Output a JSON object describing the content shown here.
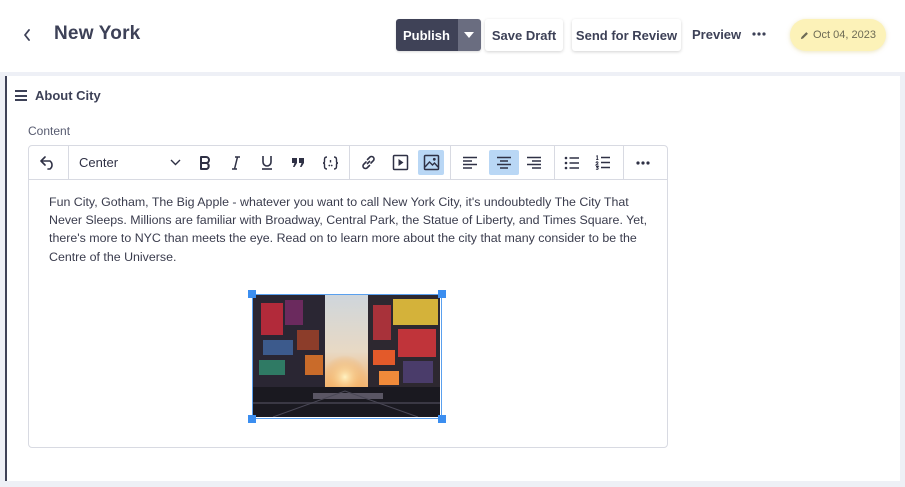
{
  "header": {
    "title": "New York",
    "publish_label": "Publish",
    "save_draft_label": "Save Draft",
    "send_review_label": "Send for Review",
    "preview_label": "Preview",
    "date": "Oct 04, 2023"
  },
  "section": {
    "title": "About City",
    "field_label": "Content"
  },
  "toolbar": {
    "alignment_selected": "Center"
  },
  "editor": {
    "body_text": "Fun City, Gotham, The Big Apple - whatever you want to call New York City, it's undoubtedly The City That Never Sleeps. Millions are familiar with Broadway, Central Park, the Statue of Liberty, and Times Square. Yet, there's more to NYC than meets the eye. Read on to learn more about the city that many consider to be the Centre of the Universe."
  },
  "colors": {
    "accent_dark": "#3f4257",
    "date_pill": "#fcf2b8",
    "active_tool": "#b9d7f5",
    "image_selection": "#3b8ef0"
  }
}
